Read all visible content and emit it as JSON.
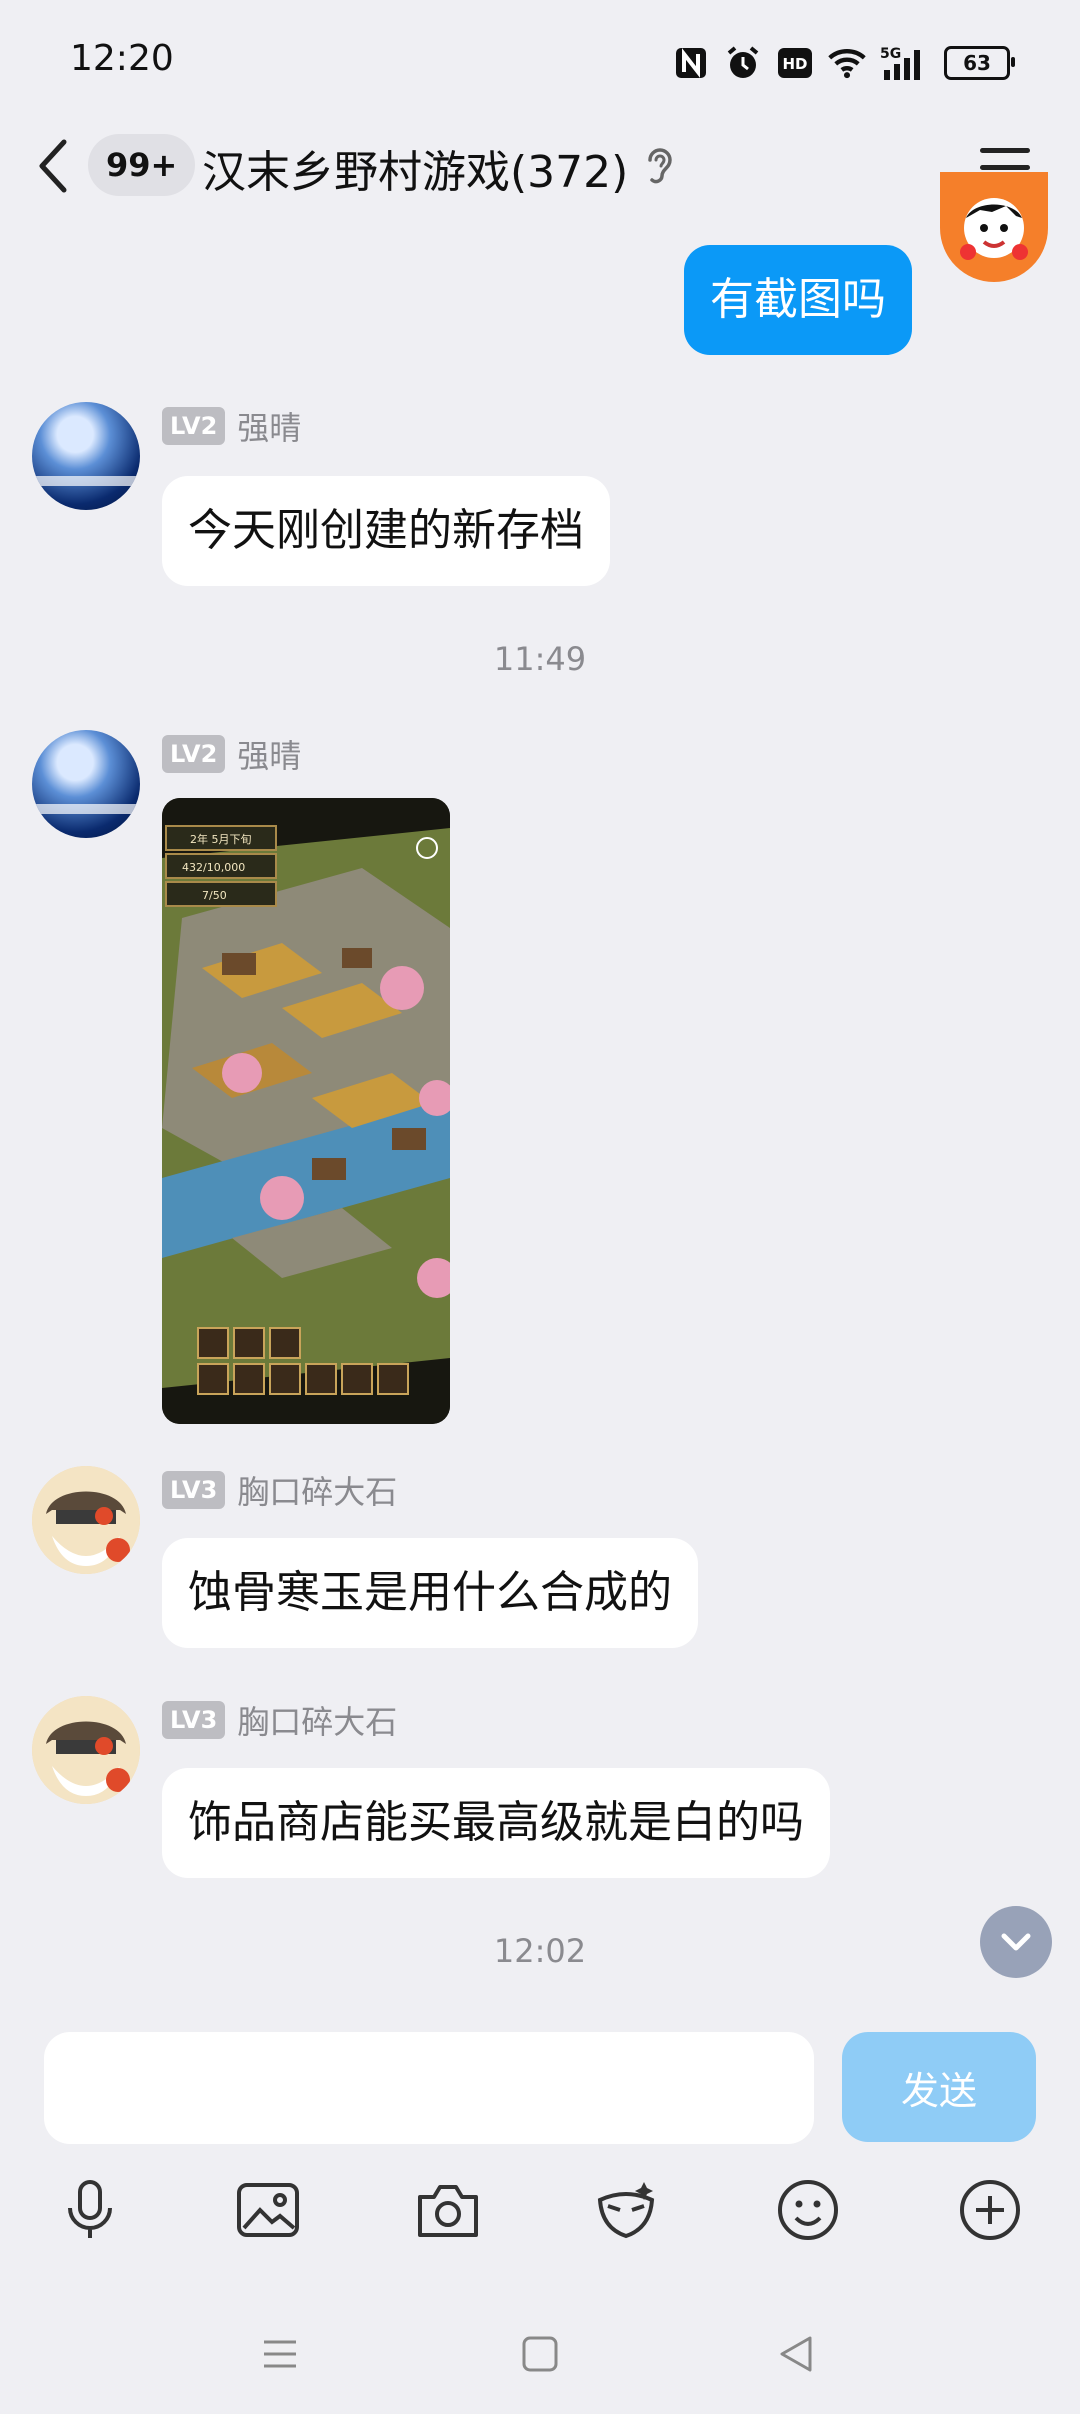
{
  "status": {
    "time": "12:20",
    "icons": [
      "nfc-icon",
      "alarm-icon",
      "hd-icon",
      "wifi-icon",
      "signal-5g-icon"
    ],
    "battery": "63"
  },
  "header": {
    "unread_badge": "99+",
    "title": "汉末乡野村游戏(372)"
  },
  "messages": {
    "self_1": {
      "text": "有截图吗"
    },
    "msg_1": {
      "level": "LV2",
      "name": "强晴",
      "text": "今天刚创建的新存档"
    },
    "time_1": "11:49",
    "msg_2": {
      "level": "LV2",
      "name": "强晴"
    },
    "msg_3": {
      "level": "LV3",
      "name": "胸口碎大石",
      "text": "蚀骨寒玉是用什么合成的"
    },
    "msg_4": {
      "level": "LV3",
      "name": "胸口碎大石",
      "text": "饰品商店能买最高级就是白的吗"
    },
    "time_2": "12:02"
  },
  "game_screenshot": {
    "date": "2年 5月下旬",
    "money": "432/10,000",
    "population": "7/50"
  },
  "composer": {
    "input_value": "",
    "send_label": "发送"
  },
  "colors": {
    "background": "#EFEFF3",
    "self_bubble": "#0B99F7",
    "send_button": "#8FCCF6"
  }
}
